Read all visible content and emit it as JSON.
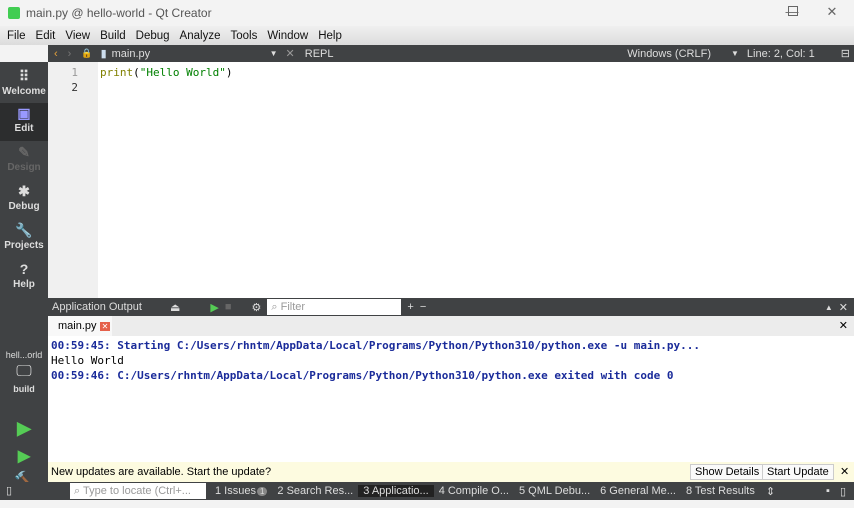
{
  "window": {
    "title": "main.py @ hello-world - Qt Creator"
  },
  "menu": [
    "File",
    "Edit",
    "View",
    "Build",
    "Debug",
    "Analyze",
    "Tools",
    "Window",
    "Help"
  ],
  "editor_toolbar": {
    "file": "main.py",
    "repl": "REPL",
    "line_ending": "Windows (CRLF)",
    "position": "Line: 2, Col: 1"
  },
  "sidebar": {
    "modes": [
      "Welcome",
      "Edit",
      "Design",
      "Debug",
      "Projects",
      "Help"
    ],
    "active": "Edit",
    "project": "hell...orld",
    "kit": "build"
  },
  "editor": {
    "line_numbers": [
      "1",
      "2"
    ],
    "code_fn": "print",
    "code_open": "(",
    "code_str": "\"Hello World\"",
    "code_close": ")"
  },
  "output_pane": {
    "title": "Application Output",
    "filter_placeholder": "Filter",
    "tab": "main.py",
    "lines": [
      "00:59:45: Starting C:/Users/rhntm/AppData/Local/Programs/Python/Python310/python.exe -u main.py...",
      "Hello World",
      "00:59:46: C:/Users/rhntm/AppData/Local/Programs/Python/Python310/python.exe exited with code 0"
    ]
  },
  "infobar": {
    "message": "New updates are available. Start the update?",
    "show_details": "Show Details",
    "start_update": "Start Update"
  },
  "statusbar": {
    "locator_placeholder": "Type to locate (Ctrl+...",
    "issues_badge": "1",
    "tabs": [
      "1 Issues",
      "2 Search Res...",
      "3 Applicatio...",
      "4 Compile O...",
      "5 QML Debu...",
      "6 General Me...",
      "8 Test Results"
    ]
  }
}
